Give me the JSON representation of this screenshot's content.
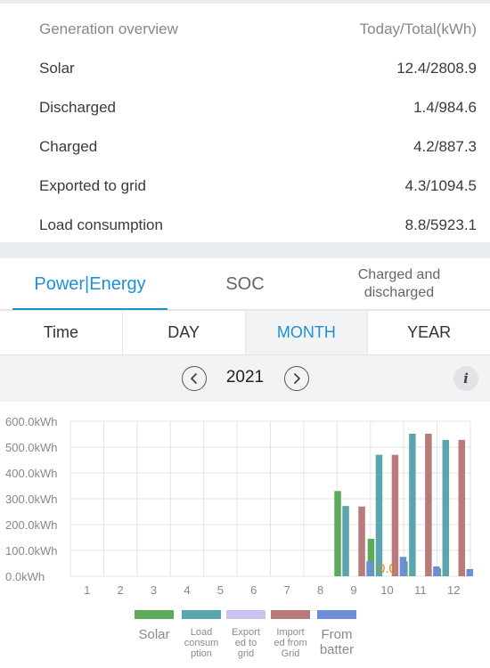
{
  "overview": {
    "title": "Generation overview",
    "unit_header": "Today/Total(kWh)",
    "rows": [
      {
        "label": "Solar",
        "value": "12.4/2808.9"
      },
      {
        "label": "Discharged",
        "value": "1.4/984.6"
      },
      {
        "label": "Charged",
        "value": "4.2/887.3"
      },
      {
        "label": "Exported to grid",
        "value": "4.3/1094.5"
      },
      {
        "label": "Load consumption",
        "value": "8.8/5923.1"
      }
    ]
  },
  "tabs": {
    "power_energy": "Power|Energy",
    "soc": "SOC",
    "charged_line1": "Charged and",
    "charged_line2": "discharged"
  },
  "periods": {
    "time": "Time",
    "day": "DAY",
    "month": "MONTH",
    "year": "YEAR",
    "active": "MONTH"
  },
  "year_nav": {
    "year": "2021",
    "prev_icon": "chevron-left-icon",
    "next_icon": "chevron-right-icon",
    "info_icon": "info-icon",
    "info_glyph": "i"
  },
  "chart_data": {
    "type": "bar",
    "categories": [
      "1",
      "2",
      "3",
      "4",
      "5",
      "6",
      "7",
      "8",
      "9",
      "10",
      "11",
      "12"
    ],
    "y_tick_labels": [
      "0.0kWh",
      "100.0kWh",
      "200.0kWh",
      "300.0kWh",
      "400.0kWh",
      "500.0kWh",
      "600.0kWh"
    ],
    "ylim": [
      0,
      600
    ],
    "grid": true,
    "legend_position": "bottom",
    "annotation": "0.0",
    "series": [
      {
        "name": "Solar",
        "color": "#5caa5a",
        "values": [
          0,
          0,
          0,
          0,
          0,
          0,
          0,
          0,
          330,
          145,
          58,
          30
        ]
      },
      {
        "name": "Load consumption",
        "label_lines": [
          "Load",
          "consum",
          "ption"
        ],
        "color": "#5aa6b0",
        "values": [
          0,
          0,
          0,
          0,
          0,
          0,
          0,
          0,
          272,
          470,
          552,
          528
        ]
      },
      {
        "name": "Export to grid",
        "label_lines": [
          "Export",
          "ed to",
          "grid"
        ],
        "color": "#c9c3f2",
        "values": [
          0,
          0,
          0,
          0,
          0,
          0,
          0,
          0,
          0,
          0,
          0,
          0
        ]
      },
      {
        "name": "Import from Grid",
        "label_lines": [
          "Import",
          "ed from",
          "Grid"
        ],
        "color": "#b87a7a",
        "values": [
          0,
          0,
          0,
          0,
          0,
          0,
          0,
          0,
          270,
          470,
          552,
          528
        ]
      },
      {
        "name": "From battery",
        "label_lines": [
          "From",
          "batter"
        ],
        "color": "#6d8fd9",
        "values": [
          0,
          0,
          0,
          0,
          0,
          0,
          0,
          0,
          58,
          75,
          38,
          28
        ]
      }
    ]
  }
}
